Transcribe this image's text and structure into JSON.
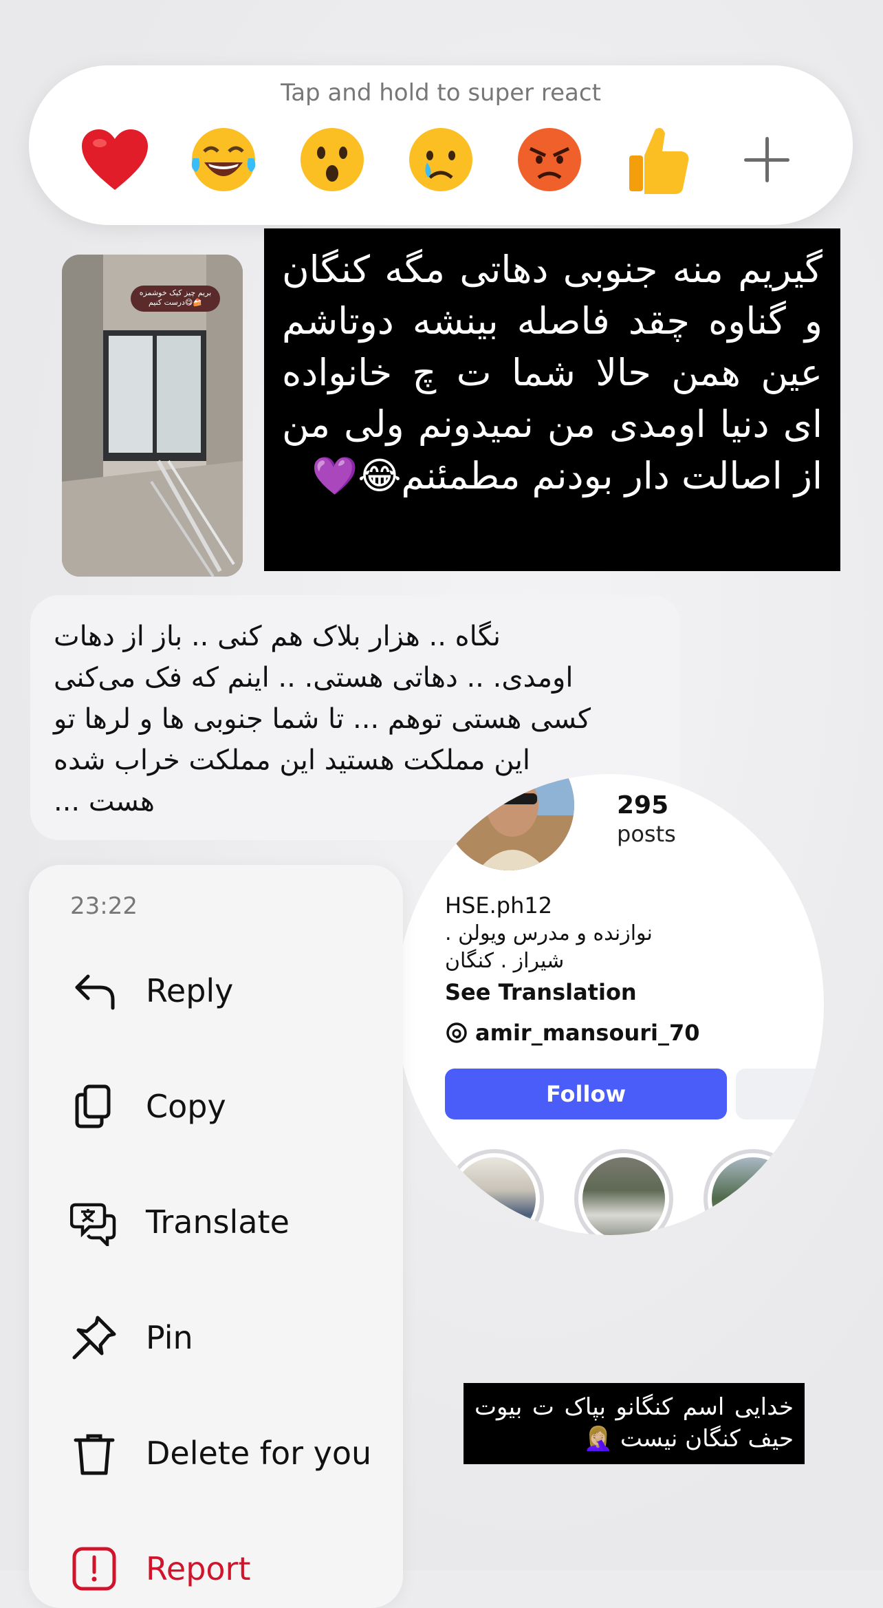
{
  "reactions": {
    "hint": "Tap and hold to super react",
    "emojis": [
      "heart-emoji",
      "laughing-tears-emoji",
      "surprised-emoji",
      "crying-emoji",
      "angry-emoji",
      "thumbs-up-emoji"
    ],
    "add_icon": "plus-icon"
  },
  "story_reply": {
    "sticker_text": "بریم چیز کیک\nخوشمزه درست کنیم😋🍰",
    "text": "گیریم منه جنوبی دهاتی مگه کنگان و گناوه چقد فاصله بینشه دوتاشم عین همن حالا شما ت چ خانواده ای دنیا اومدی من نمیدونم ولی من از اصالت دار بودنم مطمئنم😂💜"
  },
  "reply_message": {
    "lines": [
      "نگاه .. هزار بلاک هم کنی .. باز از دهات",
      "اومدی. .. دهاتی هستی. .. اینم که فک می‌کنی",
      "کسی هستی توهم ... تا شما جنوبی ها و لرها تو",
      "این مملکت هستید این مملکت خراب شده",
      "هست ..."
    ]
  },
  "menu": {
    "time": "23:22",
    "items": [
      {
        "label": "Reply",
        "icon": "reply-arrow-icon"
      },
      {
        "label": "Copy",
        "icon": "copy-icon"
      },
      {
        "label": "Translate",
        "icon": "translate-icon"
      },
      {
        "label": "Pin",
        "icon": "pin-icon"
      },
      {
        "label": "Delete for you",
        "icon": "trash-icon"
      },
      {
        "label": "Report",
        "icon": "report-icon"
      }
    ],
    "danger_color": "#d0142c"
  },
  "profile": {
    "posts_count": "295",
    "posts_label": "posts",
    "username": "HSE.ph12",
    "bio_line1": "نوازنده و مدرس ویولن .",
    "bio_line2": "شیراز . کنگان",
    "see_translation": "See Translation",
    "threads_handle": "amir_mansouri_70",
    "follow_label": "Follow",
    "follow_color": "#4a5df9"
  },
  "bottom_box": {
    "text": "خدایی اسم کنگانو بپاک ت بیوت حیف کنگان نیست 🤦🏼‍♀️"
  }
}
